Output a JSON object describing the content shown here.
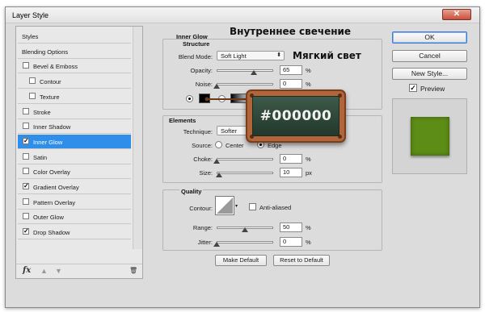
{
  "window": {
    "title": "Layer Style",
    "close_glyph": "✕"
  },
  "styles_list": {
    "items": [
      {
        "label": "Styles",
        "checkbox": false,
        "checked": false,
        "plus": false,
        "indent": 0
      },
      {
        "label": "Blending Options",
        "checkbox": false,
        "checked": false,
        "plus": false,
        "indent": 0
      },
      {
        "label": "Bevel & Emboss",
        "checkbox": true,
        "checked": false,
        "plus": false,
        "indent": 0
      },
      {
        "label": "Contour",
        "checkbox": true,
        "checked": false,
        "plus": false,
        "indent": 1
      },
      {
        "label": "Texture",
        "checkbox": true,
        "checked": false,
        "plus": false,
        "indent": 1
      },
      {
        "label": "Stroke",
        "checkbox": true,
        "checked": false,
        "plus": true,
        "indent": 0
      },
      {
        "label": "Inner Shadow",
        "checkbox": true,
        "checked": false,
        "plus": true,
        "indent": 0
      },
      {
        "label": "Inner Glow",
        "checkbox": true,
        "checked": true,
        "plus": false,
        "indent": 0,
        "selected": true
      },
      {
        "label": "Satin",
        "checkbox": true,
        "checked": false,
        "plus": false,
        "indent": 0
      },
      {
        "label": "Color Overlay",
        "checkbox": true,
        "checked": false,
        "plus": true,
        "indent": 0
      },
      {
        "label": "Gradient Overlay",
        "checkbox": true,
        "checked": true,
        "plus": true,
        "indent": 0
      },
      {
        "label": "Pattern Overlay",
        "checkbox": true,
        "checked": false,
        "plus": false,
        "indent": 0
      },
      {
        "label": "Outer Glow",
        "checkbox": true,
        "checked": false,
        "plus": false,
        "indent": 0
      },
      {
        "label": "Drop Shadow",
        "checkbox": true,
        "checked": true,
        "plus": true,
        "indent": 0
      }
    ],
    "footer_icons": [
      "fx-icon",
      "arrow-up-icon",
      "arrow-down-icon",
      "trash-icon"
    ],
    "footer_glyphs": {
      "fx": "fx",
      "up": "▲",
      "down": "▼",
      "trash": "🗑"
    }
  },
  "inner_glow": {
    "heading": "Inner Glow",
    "structure": {
      "title": "Structure",
      "blend_mode_label": "Blend Mode:",
      "blend_mode_value": "Soft Light",
      "opacity_label": "Opacity:",
      "opacity_value": "65",
      "opacity_unit": "%",
      "opacity_fraction": 0.65,
      "noise_label": "Noise:",
      "noise_value": "0",
      "noise_unit": "%",
      "noise_fraction": 0.0
    },
    "elements": {
      "title": "Elements",
      "technique_label": "Technique:",
      "technique_value": "Softer",
      "source_label": "Source:",
      "source_center": "Center",
      "source_edge": "Edge",
      "source_selected": "Edge",
      "choke_label": "Choke:",
      "choke_value": "0",
      "choke_unit": "%",
      "choke_fraction": 0.0,
      "size_label": "Size:",
      "size_value": "10",
      "size_unit": "px",
      "size_fraction": 0.04
    },
    "quality": {
      "title": "Quality",
      "contour_label": "Contour:",
      "anti_aliased_label": "Anti-aliased",
      "range_label": "Range:",
      "range_value": "50",
      "range_unit": "%",
      "range_fraction": 0.5,
      "jitter_label": "Jitter:",
      "jitter_value": "0",
      "jitter_unit": "%",
      "jitter_fraction": 0.0
    },
    "make_default_label": "Make Default",
    "reset_default_label": "Reset to Default"
  },
  "annotations": {
    "inner_glow_ru": "Внутреннее свечение",
    "soft_light_ru": "Мягкий свет",
    "color_code": "#000000"
  },
  "buttons": {
    "ok": "OK",
    "cancel": "Cancel",
    "new_style": "New Style...",
    "preview_label": "Preview",
    "preview_checked": true
  },
  "colors": {
    "selected_row": "#2f8ee9",
    "glow_color": "#000000",
    "preview_swatch": "#5d8d16"
  }
}
